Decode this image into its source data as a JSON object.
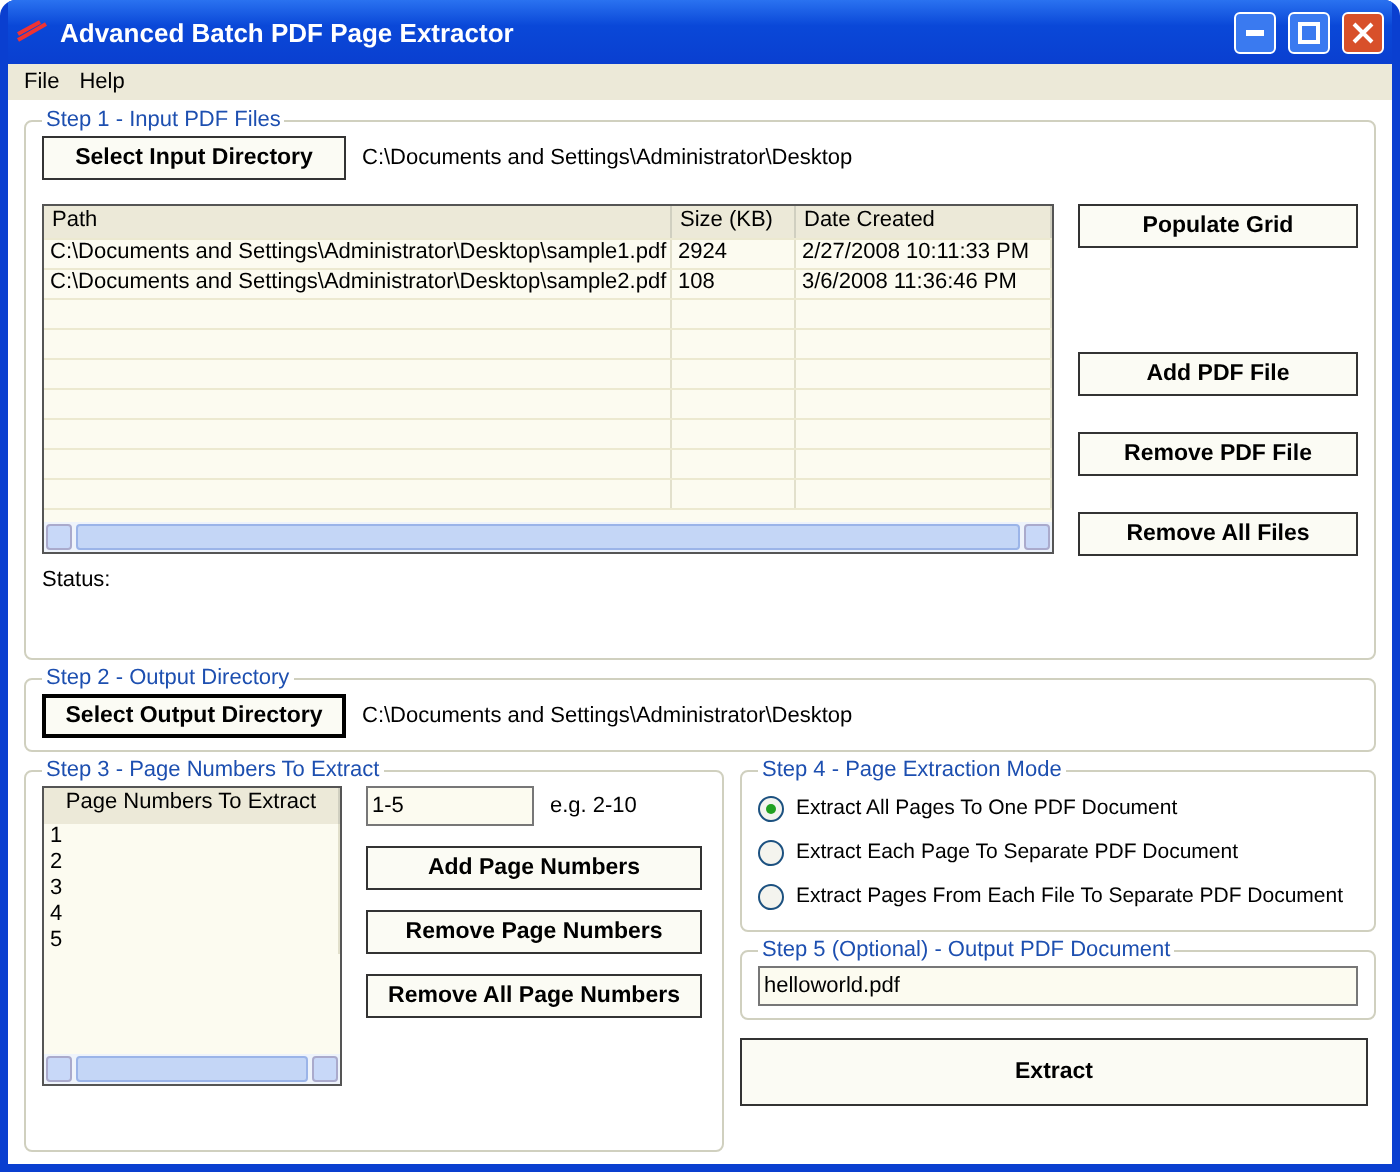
{
  "window": {
    "title": "Advanced Batch PDF Page Extractor"
  },
  "menu": [
    "File",
    "Help"
  ],
  "step1": {
    "title": "Step 1 - Input PDF Files",
    "select_button": "Select Input Directory",
    "directory": "C:\\Documents and Settings\\Administrator\\Desktop",
    "columns": [
      "Path",
      "Size (KB)",
      "Date Created"
    ],
    "rows": [
      [
        "C:\\Documents and Settings\\Administrator\\Desktop\\sample1.pdf",
        "2924",
        "2/27/2008 10:11:33 PM"
      ],
      [
        "C:\\Documents and Settings\\Administrator\\Desktop\\sample2.pdf",
        "108",
        "3/6/2008 11:36:46 PM"
      ]
    ],
    "buttons": [
      "Populate Grid",
      "Add PDF File",
      "Remove PDF File",
      "Remove All Files"
    ],
    "status_label": "Status:"
  },
  "step2": {
    "title": "Step 2 - Output Directory",
    "select_button": "Select Output Directory",
    "directory": "C:\\Documents and Settings\\Administrator\\Desktop"
  },
  "step3": {
    "title": "Step 3 - Page Numbers To Extract",
    "column": "Page Numbers To Extract",
    "pages": [
      "1",
      "2",
      "3",
      "4",
      "5"
    ],
    "range_value": "1-5",
    "hint": "e.g. 2-10",
    "buttons": [
      "Add Page Numbers",
      "Remove Page Numbers",
      "Remove All Page Numbers"
    ]
  },
  "step4": {
    "title": "Step 4 - Page Extraction Mode",
    "options": [
      {
        "label": "Extract All Pages To One PDF Document",
        "selected": true
      },
      {
        "label": "Extract Each Page To Separate PDF Document",
        "selected": false
      },
      {
        "label": "Extract Pages From Each File To Separate PDF Document",
        "selected": false
      }
    ]
  },
  "step5": {
    "title": "Step 5 (Optional) - Output PDF Document",
    "file_name": "helloworld.pdf"
  },
  "extract_button": "Extract"
}
